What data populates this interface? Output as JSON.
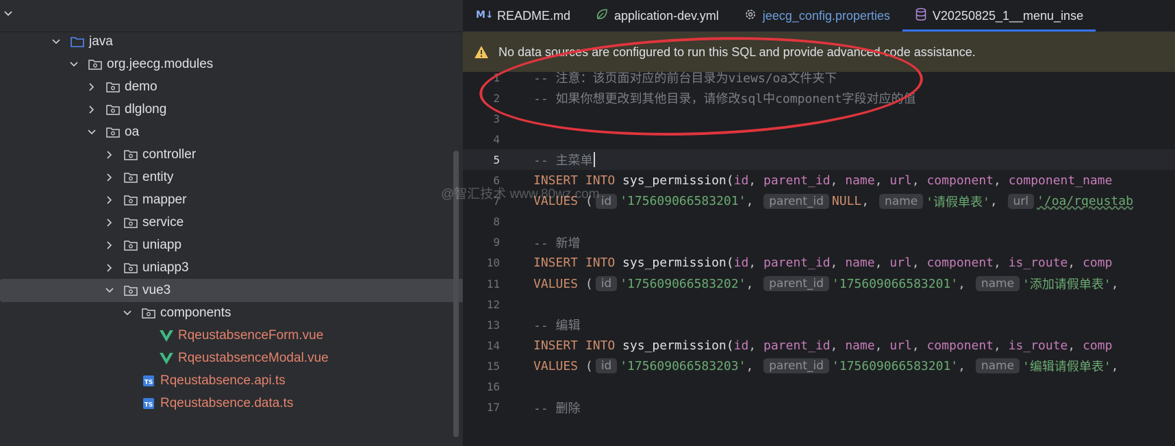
{
  "tree": {
    "rows": [
      {
        "label": "java",
        "depth": 0,
        "expand": "open",
        "icon": "source-folder-icon",
        "file": false
      },
      {
        "label": "org.jeecg.modules",
        "depth": 1,
        "expand": "open",
        "icon": "package-icon",
        "file": false
      },
      {
        "label": "demo",
        "depth": 2,
        "expand": "closed",
        "icon": "package-icon",
        "file": false
      },
      {
        "label": "dlglong",
        "depth": 2,
        "expand": "closed",
        "icon": "package-icon",
        "file": false
      },
      {
        "label": "oa",
        "depth": 2,
        "expand": "open",
        "icon": "package-icon",
        "file": false
      },
      {
        "label": "controller",
        "depth": 3,
        "expand": "closed",
        "icon": "package-icon",
        "file": false
      },
      {
        "label": "entity",
        "depth": 3,
        "expand": "closed",
        "icon": "package-icon",
        "file": false
      },
      {
        "label": "mapper",
        "depth": 3,
        "expand": "closed",
        "icon": "package-icon",
        "file": false
      },
      {
        "label": "service",
        "depth": 3,
        "expand": "closed",
        "icon": "package-icon",
        "file": false
      },
      {
        "label": "uniapp",
        "depth": 3,
        "expand": "closed",
        "icon": "package-icon",
        "file": false
      },
      {
        "label": "uniapp3",
        "depth": 3,
        "expand": "closed",
        "icon": "package-icon",
        "file": false
      },
      {
        "label": "vue3",
        "depth": 3,
        "expand": "open",
        "icon": "package-icon",
        "file": false,
        "selected": true
      },
      {
        "label": "components",
        "depth": 4,
        "expand": "open",
        "icon": "package-icon",
        "file": false
      },
      {
        "label": "RqeustabsenceForm.vue",
        "depth": 5,
        "expand": "none",
        "icon": "vue-file-icon",
        "file": true
      },
      {
        "label": "RqeustabsenceModal.vue",
        "depth": 5,
        "expand": "none",
        "icon": "vue-file-icon",
        "file": true
      },
      {
        "label": "Rqeustabsence.api.ts",
        "depth": 4,
        "expand": "none",
        "icon": "typescript-file-icon",
        "file": true
      },
      {
        "label": "Rqeustabsence.data.ts",
        "depth": 4,
        "expand": "none",
        "icon": "typescript-file-icon",
        "file": true
      }
    ]
  },
  "tabs": [
    {
      "label": "README.md",
      "icon": "markdown-icon",
      "style": "normal"
    },
    {
      "label": "application-dev.yml",
      "icon": "spring-config-icon",
      "style": "normal"
    },
    {
      "label": "jeecg_config.properties",
      "icon": "gear-icon",
      "style": "blue"
    },
    {
      "label": "V20250825_1__menu_inse",
      "icon": "database-icon",
      "style": "normal",
      "active": true
    }
  ],
  "banner": {
    "text": "No data sources are configured to run this SQL and provide advanced code assistance.",
    "icon": "warning-icon"
  },
  "code": {
    "current_line": 5,
    "lines": [
      {
        "n": "1",
        "segs": [
          [
            "cmt",
            "-- 注意：该页面对应的前台目录为views/oa文件夹下"
          ]
        ]
      },
      {
        "n": "2",
        "segs": [
          [
            "cmt",
            "-- 如果你想更改到其他目录，请修改sql中component字段对应的值"
          ]
        ]
      },
      {
        "n": "3",
        "segs": []
      },
      {
        "n": "4",
        "segs": []
      },
      {
        "n": "5",
        "segs": [
          [
            "cmt",
            "-- 主菜单"
          ],
          [
            "caret",
            ""
          ]
        ]
      },
      {
        "n": "6",
        "segs": [
          [
            "kw",
            "INSERT INTO "
          ],
          [
            "fn",
            "sys_permission("
          ],
          [
            "col",
            "id"
          ],
          [
            "pun",
            ", "
          ],
          [
            "col",
            "parent_id"
          ],
          [
            "pun",
            ", "
          ],
          [
            "col",
            "name"
          ],
          [
            "pun",
            ", "
          ],
          [
            "col",
            "url"
          ],
          [
            "pun",
            ", "
          ],
          [
            "col",
            "component"
          ],
          [
            "pun",
            ", "
          ],
          [
            "col",
            "component_name"
          ]
        ]
      },
      {
        "n": "7",
        "segs": [
          [
            "kw",
            "VALUES "
          ],
          [
            "pun",
            "("
          ],
          [
            "hint",
            "id"
          ],
          [
            "str",
            "'175609066583201'"
          ],
          [
            "pun",
            ", "
          ],
          [
            "hint",
            "parent_id"
          ],
          [
            "kw",
            "NULL"
          ],
          [
            "pun",
            ", "
          ],
          [
            "hint",
            "name"
          ],
          [
            "str",
            "'请假单表'"
          ],
          [
            "pun",
            ", "
          ],
          [
            "hint",
            "url"
          ],
          [
            "squig",
            "'/oa/rqeustab"
          ]
        ]
      },
      {
        "n": "8",
        "segs": []
      },
      {
        "n": "9",
        "segs": [
          [
            "cmt",
            "-- 新增"
          ]
        ]
      },
      {
        "n": "10",
        "segs": [
          [
            "kw",
            "INSERT INTO "
          ],
          [
            "fn",
            "sys_permission("
          ],
          [
            "col",
            "id"
          ],
          [
            "pun",
            ", "
          ],
          [
            "col",
            "parent_id"
          ],
          [
            "pun",
            ", "
          ],
          [
            "col",
            "name"
          ],
          [
            "pun",
            ", "
          ],
          [
            "col",
            "url"
          ],
          [
            "pun",
            ", "
          ],
          [
            "col",
            "component"
          ],
          [
            "pun",
            ", "
          ],
          [
            "col",
            "is_route"
          ],
          [
            "pun",
            ", "
          ],
          [
            "col",
            "comp"
          ]
        ]
      },
      {
        "n": "11",
        "segs": [
          [
            "kw",
            "VALUES "
          ],
          [
            "pun",
            "("
          ],
          [
            "hint",
            "id"
          ],
          [
            "str",
            "'175609066583202'"
          ],
          [
            "pun",
            ", "
          ],
          [
            "hint",
            "parent_id"
          ],
          [
            "str",
            "'175609066583201'"
          ],
          [
            "pun",
            ", "
          ],
          [
            "hint",
            "name"
          ],
          [
            "str",
            "'添加请假单表'"
          ],
          [
            "pun",
            ", "
          ]
        ]
      },
      {
        "n": "12",
        "segs": []
      },
      {
        "n": "13",
        "segs": [
          [
            "cmt",
            "-- 编辑"
          ]
        ]
      },
      {
        "n": "14",
        "segs": [
          [
            "kw",
            "INSERT INTO "
          ],
          [
            "fn",
            "sys_permission("
          ],
          [
            "col",
            "id"
          ],
          [
            "pun",
            ", "
          ],
          [
            "col",
            "parent_id"
          ],
          [
            "pun",
            ", "
          ],
          [
            "col",
            "name"
          ],
          [
            "pun",
            ", "
          ],
          [
            "col",
            "url"
          ],
          [
            "pun",
            ", "
          ],
          [
            "col",
            "component"
          ],
          [
            "pun",
            ", "
          ],
          [
            "col",
            "is_route"
          ],
          [
            "pun",
            ", "
          ],
          [
            "col",
            "comp"
          ]
        ]
      },
      {
        "n": "15",
        "segs": [
          [
            "kw",
            "VALUES "
          ],
          [
            "pun",
            "("
          ],
          [
            "hint",
            "id"
          ],
          [
            "str",
            "'175609066583203'"
          ],
          [
            "pun",
            ", "
          ],
          [
            "hint",
            "parent_id"
          ],
          [
            "str",
            "'175609066583201'"
          ],
          [
            "pun",
            ", "
          ],
          [
            "hint",
            "name"
          ],
          [
            "str",
            "'编辑请假单表'"
          ],
          [
            "pun",
            ", "
          ]
        ]
      },
      {
        "n": "16",
        "segs": []
      },
      {
        "n": "17",
        "segs": [
          [
            "cmt",
            "-- 删除"
          ]
        ]
      }
    ]
  },
  "watermark": "@智汇技术 www.80wz.com",
  "colors": {
    "accent": "#3574f0",
    "annotation": "#e0353d",
    "warning": "#f2c55c"
  }
}
